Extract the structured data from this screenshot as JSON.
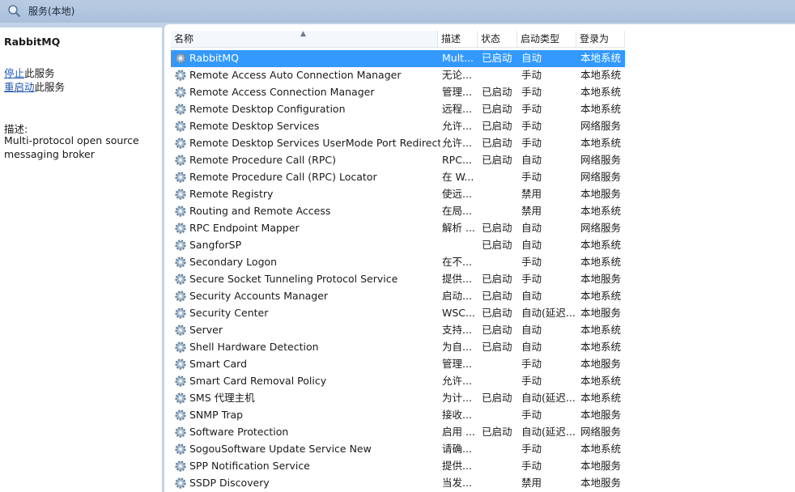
{
  "window": {
    "title": "服务(本地)",
    "icon": "services-magnifier-icon"
  },
  "details": {
    "service_name": "RabbitMQ",
    "stop_link": "停止",
    "stop_suffix": "此服务",
    "restart_link": "重启动",
    "restart_suffix": "此服务",
    "description_label": "描述:",
    "description": "Multi-protocol open source messaging broker"
  },
  "table": {
    "columns": {
      "name": "名称",
      "description": "描述",
      "status": "状态",
      "startup_type": "启动类型",
      "log_on_as": "登录为"
    },
    "sort_icon": "sort-ascending-icon",
    "row_icon": "gear-icon",
    "rows": [
      {
        "name": "RabbitMQ",
        "description": "Mult...",
        "status": "已启动",
        "startup": "自动",
        "logon": "本地系统"
      },
      {
        "name": "Remote Access Auto Connection Manager",
        "description": "无论...",
        "status": "",
        "startup": "手动",
        "logon": "本地系统"
      },
      {
        "name": "Remote Access Connection Manager",
        "description": "管理...",
        "status": "已启动",
        "startup": "手动",
        "logon": "本地系统"
      },
      {
        "name": "Remote Desktop Configuration",
        "description": "远程...",
        "status": "已启动",
        "startup": "手动",
        "logon": "本地系统"
      },
      {
        "name": "Remote Desktop Services",
        "description": "允许...",
        "status": "已启动",
        "startup": "手动",
        "logon": "网络服务"
      },
      {
        "name": "Remote Desktop Services UserMode Port Redirect...",
        "description": "允许...",
        "status": "已启动",
        "startup": "手动",
        "logon": "本地系统"
      },
      {
        "name": "Remote Procedure Call (RPC)",
        "description": "RPC...",
        "status": "已启动",
        "startup": "自动",
        "logon": "网络服务"
      },
      {
        "name": "Remote Procedure Call (RPC) Locator",
        "description": "在 W...",
        "status": "",
        "startup": "手动",
        "logon": "网络服务"
      },
      {
        "name": "Remote Registry",
        "description": "使远...",
        "status": "",
        "startup": "禁用",
        "logon": "本地服务"
      },
      {
        "name": "Routing and Remote Access",
        "description": "在局...",
        "status": "",
        "startup": "禁用",
        "logon": "本地系统"
      },
      {
        "name": "RPC Endpoint Mapper",
        "description": "解析 ...",
        "status": "已启动",
        "startup": "自动",
        "logon": "网络服务"
      },
      {
        "name": "SangforSP",
        "description": "",
        "status": "已启动",
        "startup": "自动",
        "logon": "本地系统"
      },
      {
        "name": "Secondary Logon",
        "description": "在不...",
        "status": "",
        "startup": "手动",
        "logon": "本地系统"
      },
      {
        "name": "Secure Socket Tunneling Protocol Service",
        "description": "提供...",
        "status": "已启动",
        "startup": "手动",
        "logon": "本地服务"
      },
      {
        "name": "Security Accounts Manager",
        "description": "启动...",
        "status": "已启动",
        "startup": "自动",
        "logon": "本地系统"
      },
      {
        "name": "Security Center",
        "description": "WSC...",
        "status": "已启动",
        "startup": "自动(延迟...",
        "logon": "本地服务"
      },
      {
        "name": "Server",
        "description": "支持...",
        "status": "已启动",
        "startup": "自动",
        "logon": "本地系统"
      },
      {
        "name": "Shell Hardware Detection",
        "description": "为自...",
        "status": "已启动",
        "startup": "自动",
        "logon": "本地系统"
      },
      {
        "name": "Smart Card",
        "description": "管理...",
        "status": "",
        "startup": "手动",
        "logon": "本地服务"
      },
      {
        "name": "Smart Card Removal Policy",
        "description": "允许...",
        "status": "",
        "startup": "手动",
        "logon": "本地系统"
      },
      {
        "name": "SMS 代理主机",
        "description": "为计...",
        "status": "已启动",
        "startup": "自动(延迟...",
        "logon": "本地系统"
      },
      {
        "name": "SNMP Trap",
        "description": "接收...",
        "status": "",
        "startup": "手动",
        "logon": "本地服务"
      },
      {
        "name": "Software Protection",
        "description": "启用 ...",
        "status": "已启动",
        "startup": "自动(延迟...",
        "logon": "网络服务"
      },
      {
        "name": "SogouSoftware Update Service New",
        "description": "请确...",
        "status": "",
        "startup": "手动",
        "logon": "本地系统"
      },
      {
        "name": "SPP Notification Service",
        "description": "提供...",
        "status": "",
        "startup": "手动",
        "logon": "本地服务"
      },
      {
        "name": "SSDP Discovery",
        "description": "当发...",
        "status": "",
        "startup": "禁用",
        "logon": "本地服务"
      }
    ]
  },
  "colors": {
    "selection": "#3399ff",
    "link": "#1f57b0",
    "chrome": "#c3d3e7"
  }
}
